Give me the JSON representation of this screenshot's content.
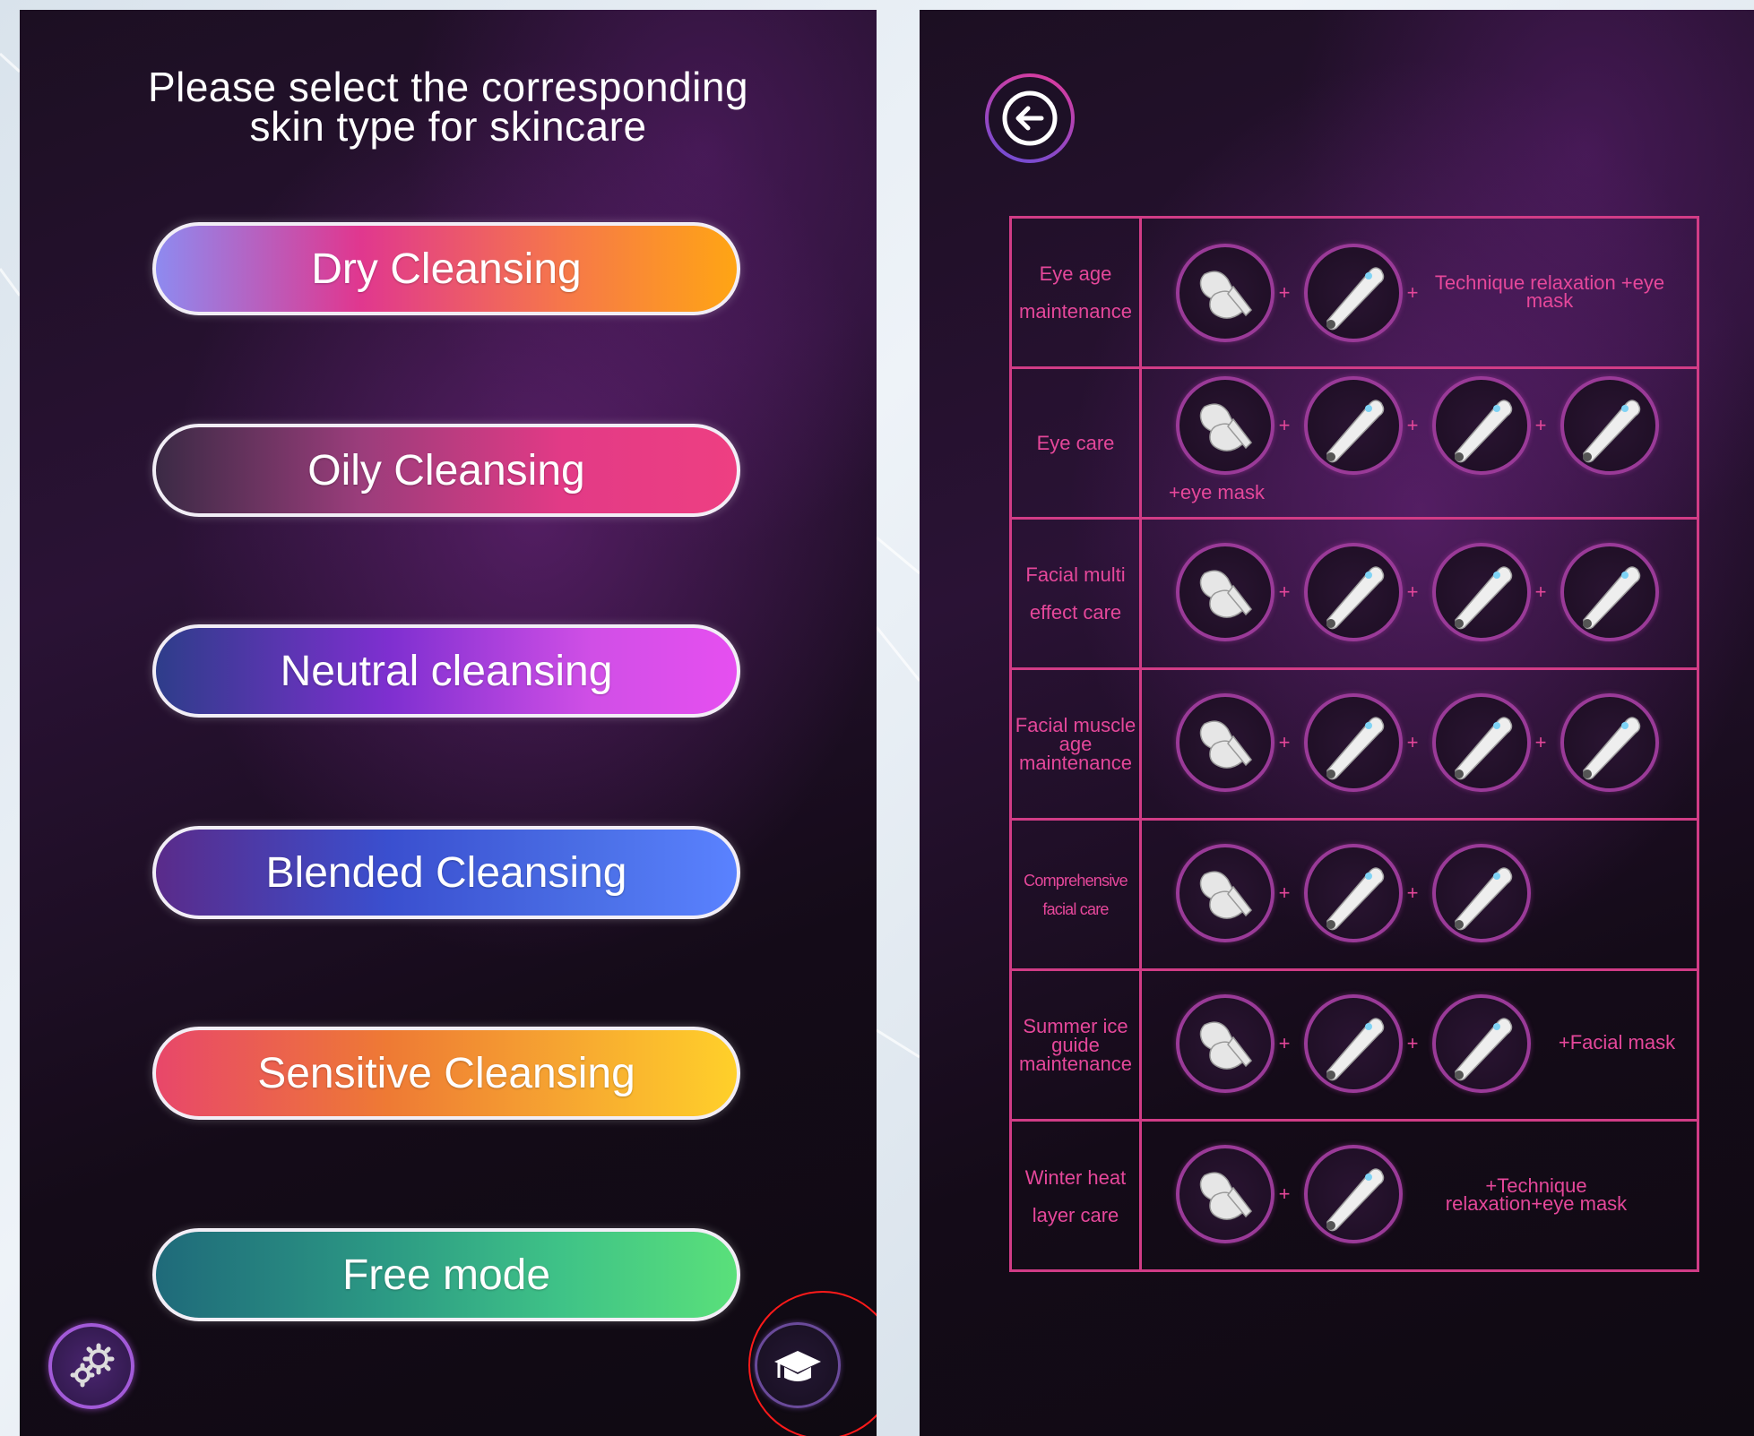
{
  "left": {
    "title_line1": "Please select the corresponding",
    "title_line2": "skin type for skincare",
    "modes": [
      "Dry Cleansing",
      "Oily Cleansing",
      "Neutral cleansing",
      "Blended Cleansing",
      "Sensitive Cleansing",
      "Free mode"
    ],
    "settings_icon": "gears-icon",
    "tutorial_icon": "graduation-cap-icon"
  },
  "right": {
    "back_icon": "back-arrow-icon",
    "plus": "+",
    "programs": [
      {
        "name": "Eye age maintenance",
        "note": "Technique relaxation +eye mask"
      },
      {
        "name": "Eye care",
        "note": "+eye mask"
      },
      {
        "name": "Facial multi effect care",
        "note": ""
      },
      {
        "name": "Facial muscle age maintenance",
        "note": ""
      },
      {
        "name": "Comprehensive facial care",
        "note": ""
      },
      {
        "name": "Summer ice guide maintenance",
        "note": "+Facial mask"
      },
      {
        "name": "Winter heat layer care",
        "note": "+Technique relaxation+eye mask"
      }
    ]
  },
  "colors": {
    "accent_pink": "#e5479a",
    "table_border": "#d13c86",
    "highlight_circle": "#ff1a1a"
  }
}
